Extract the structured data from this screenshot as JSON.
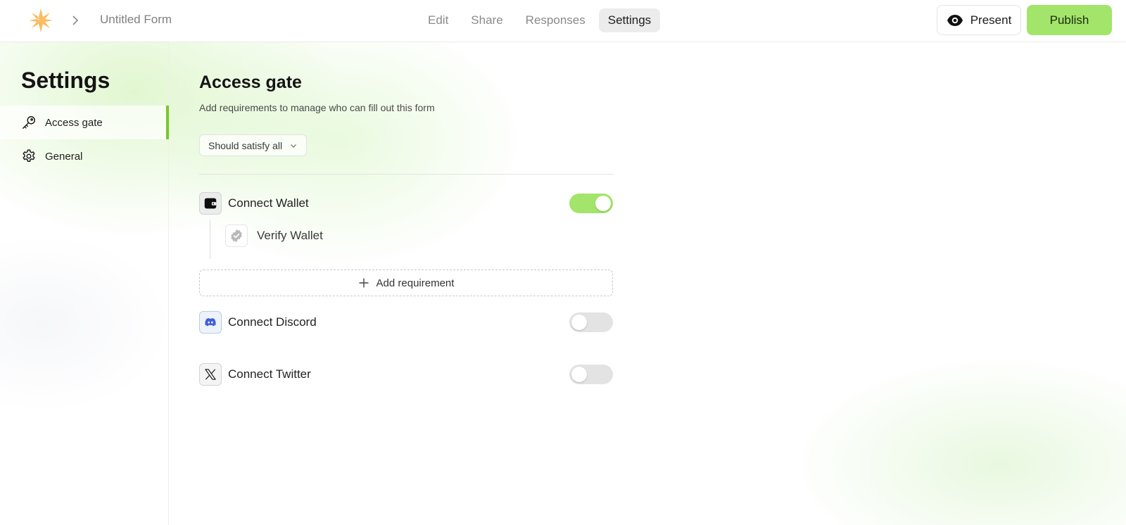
{
  "topbar": {
    "logo_icon": "star-burst-logo",
    "breadcrumb_chevron": "chevron-right-icon",
    "form_title": "Untitled Form",
    "tabs": [
      {
        "label": "Edit",
        "active": false
      },
      {
        "label": "Share",
        "active": false
      },
      {
        "label": "Responses",
        "active": false
      },
      {
        "label": "Settings",
        "active": true
      }
    ],
    "present_label": "Present",
    "present_icon": "eye-icon",
    "publish_label": "Publish"
  },
  "sidebar": {
    "title": "Settings",
    "items": [
      {
        "label": "Access gate",
        "icon": "key-icon",
        "active": true
      },
      {
        "label": "General",
        "icon": "gear-icon",
        "active": false
      }
    ]
  },
  "main": {
    "title": "Access gate",
    "subtitle": "Add requirements to manage who can fill out this form",
    "condition_select": {
      "value": "Should satisfy all",
      "icon": "chevron-down-icon"
    },
    "requirements": [
      {
        "label": "Connect Wallet",
        "icon": "wallet-icon",
        "enabled": true,
        "sub_requirements": [
          {
            "label": "Verify Wallet",
            "icon": "verified-badge-icon"
          }
        ]
      },
      {
        "label": "Connect Discord",
        "icon": "discord-icon",
        "enabled": false
      },
      {
        "label": "Connect Twitter",
        "icon": "x-twitter-icon",
        "enabled": false
      }
    ],
    "add_requirement_label": "Add requirement",
    "add_requirement_icon": "plus-icon"
  },
  "colors": {
    "accent_green": "#a3e46a",
    "active_indicator": "#7ac72f",
    "discord_blue": "#3f5fe0",
    "logo_orange": "#f9bd63"
  }
}
